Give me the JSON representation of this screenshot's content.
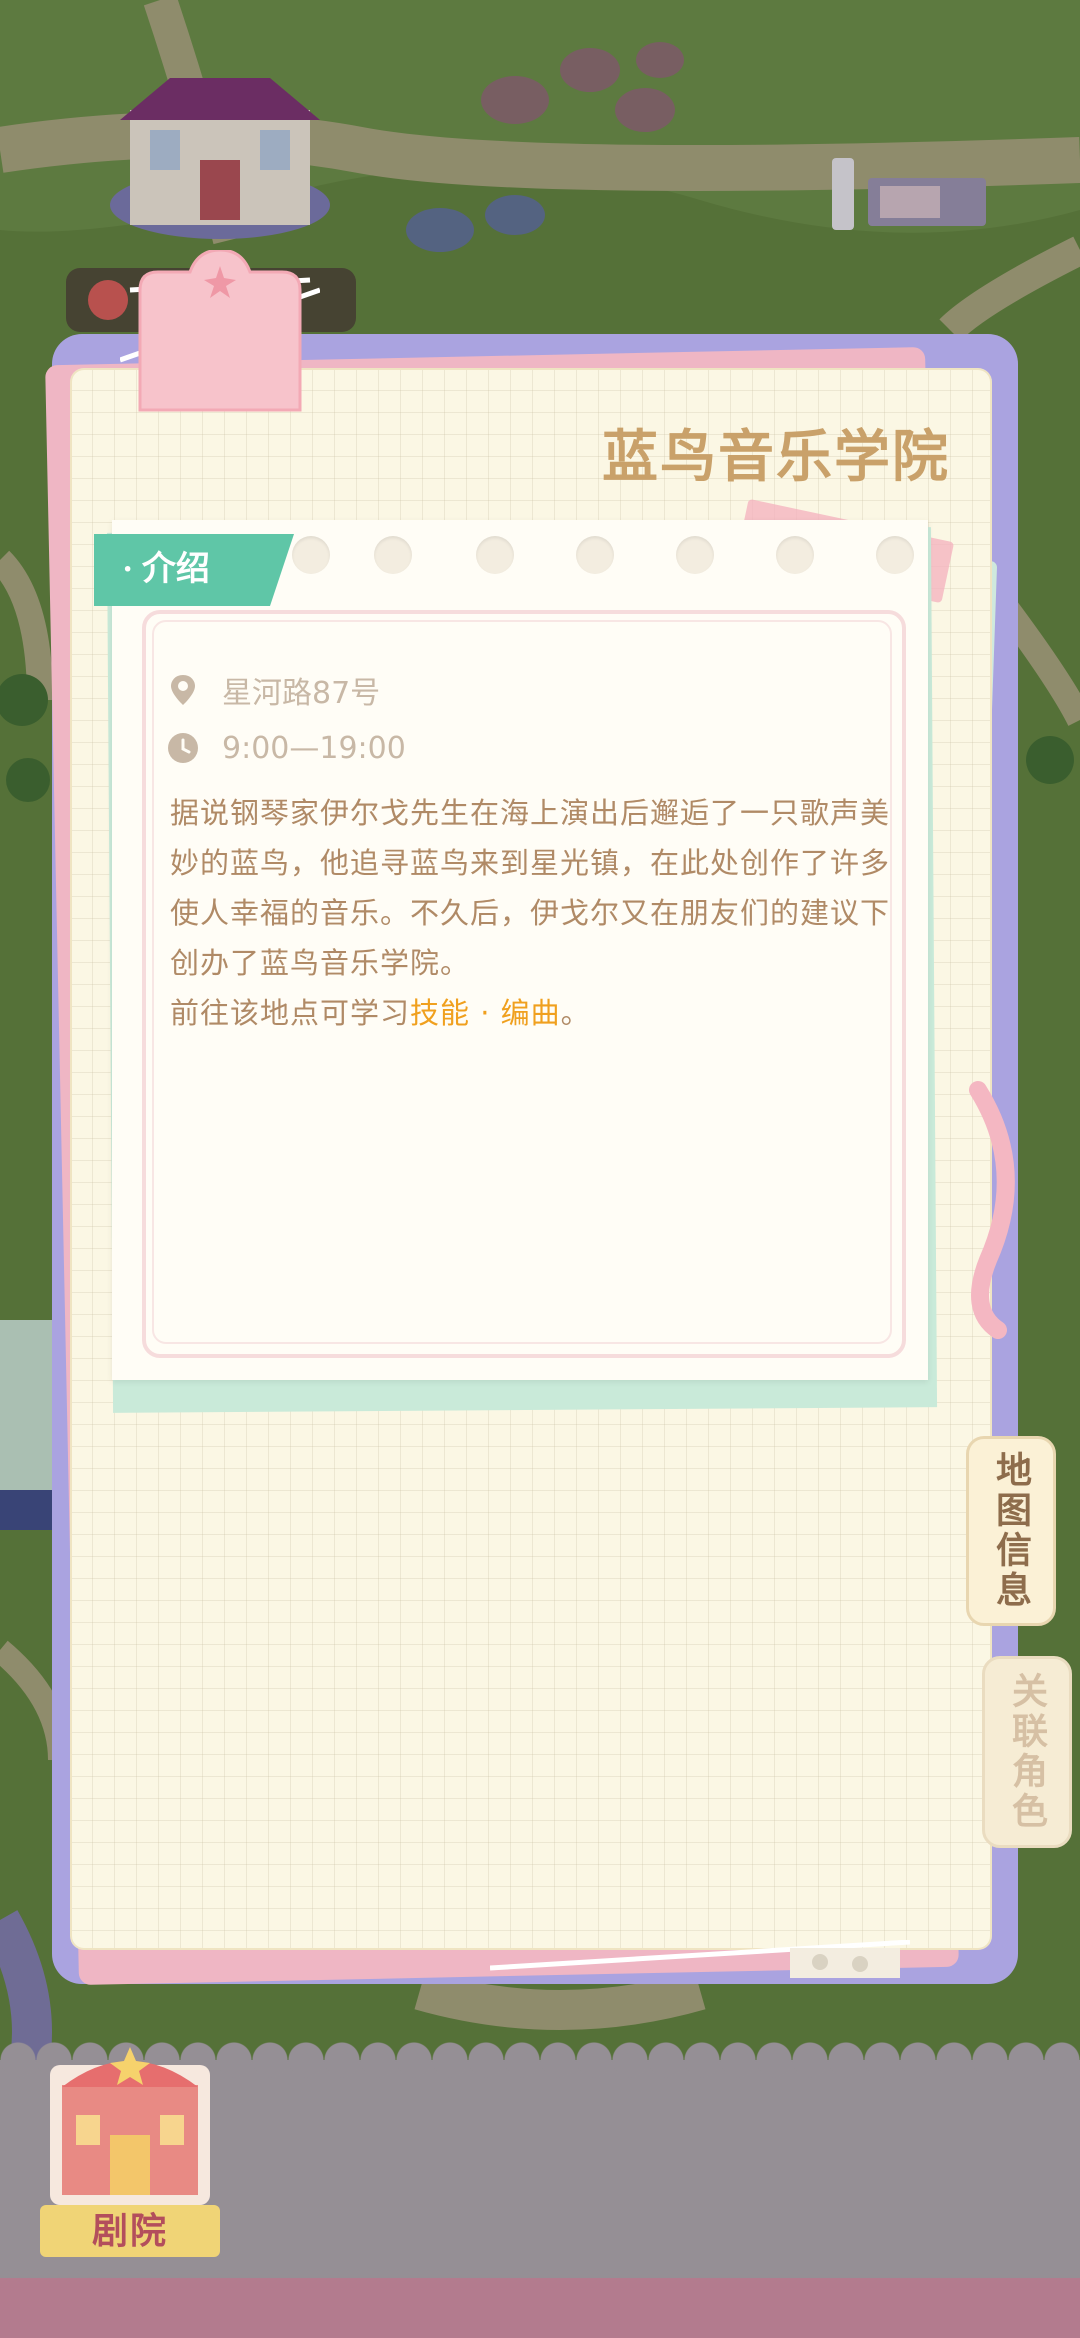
{
  "location": {
    "title": "蓝鸟音乐学院",
    "intro_tab": "· 介绍",
    "address": "星河路87号",
    "hours": "9:00—19:00",
    "description": "据说钢琴家伊尔戈先生在海上演出后邂逅了一只歌声美妙的蓝鸟，他追寻蓝鸟来到星光镇，在此处创作了许多使人幸福的音乐。不久后，伊戈尔又在朋友们的建议下创办了蓝鸟音乐学院。",
    "learn_prefix": "前往该地点可学习",
    "learn_skill": "技能 · 编曲",
    "learn_suffix": "。"
  },
  "side_tabs": {
    "map_info": "地图信息",
    "related_roles": "关联角色"
  },
  "bottom": {
    "theater_label": "剧院"
  },
  "icons": [
    "location-pin-icon",
    "clock-icon"
  ],
  "colors": {
    "accent_green": "#5fc6a7",
    "title_gold": "#c9a16a",
    "highlight_orange": "#f0a01e",
    "panel_purple": "#aaa3e0"
  }
}
